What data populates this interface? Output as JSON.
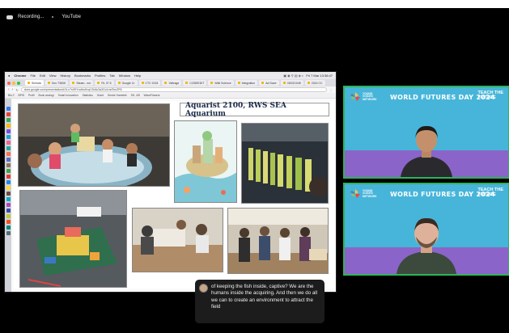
{
  "topbar": {
    "recording_label": "Recording...",
    "app_label": "YouTube"
  },
  "browser": {
    "menubar": [
      "Chrome",
      "File",
      "Edit",
      "View",
      "History",
      "Bookmarks",
      "Profiles",
      "Tab",
      "Window",
      "Help"
    ],
    "clock": "Fri 7 Mar 13:36:47",
    "tabs": [
      "Sinhala",
      "Gov T360K",
      "Steam - ecr",
      "RL 37.5",
      "Google Cr",
      "CTC 2024",
      "Veltrage",
      "CODEEDIT",
      "Wild Science",
      "Integration",
      "Ad Dave",
      "CBSZ1045",
      "2024 CC"
    ],
    "url": "docs.google.com/presentation/d/1Ln7s9SYnoIbsKnqV1b6c3a3Go1mdTonZR0",
    "bookmarks": [
      "Bio 2",
      "BPIS",
      "Profil",
      "Book anologi",
      "Smart Innovation",
      "Statistics",
      "Grant",
      "Senior Hometek",
      "SH, 4/8",
      "WaveFlowers"
    ]
  },
  "slide": {
    "title": "Aquarist 2100, RWS SEA Aquarium"
  },
  "participants": [
    {
      "event_title": "WORLD FUTURES DAY 2024",
      "logo_text": "YOUNG VOICES NETWORK",
      "org_text": "TEACH THE FUTURE"
    },
    {
      "event_title": "WORLD FUTURES DAY 2024",
      "logo_text": "YOUNG VOICES NETWORK",
      "org_text": "TEACH THE FUTURE"
    }
  ],
  "caption": {
    "text": "of keeping the fish inside, captive? We are the humans inside the acquiring. And then we do all we can to create an environment to attract the field"
  },
  "colors": {
    "tile_bg": "#47b5d9",
    "tile_band": "#8a64c8",
    "active_speaker_border": "#2fb35a",
    "title_text": "#1b2a4a"
  }
}
